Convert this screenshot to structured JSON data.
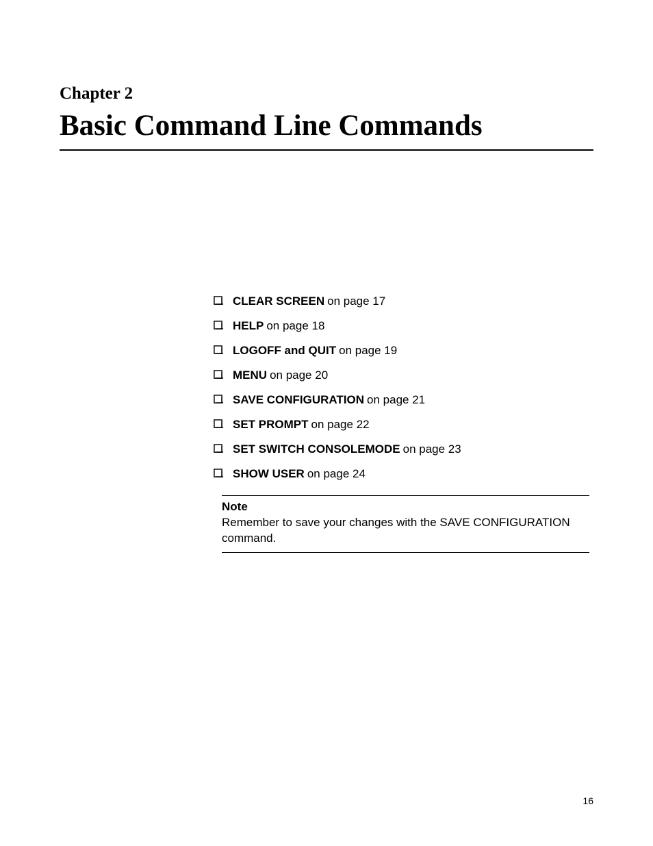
{
  "chapter": {
    "label": "Chapter 2",
    "title": "Basic Command Line Commands"
  },
  "commands": [
    {
      "name": "CLEAR SCREEN",
      "page": "on page 17"
    },
    {
      "name": "HELP",
      "page": "on page 18"
    },
    {
      "name": "LOGOFF and QUIT",
      "page": "on page 19"
    },
    {
      "name": "MENU",
      "page": "on page 20"
    },
    {
      "name": "SAVE CONFIGURATION",
      "page": "on page 21"
    },
    {
      "name": "SET PROMPT",
      "page": "on page 22"
    },
    {
      "name": "SET SWITCH CONSOLEMODE",
      "page": "on page 23"
    },
    {
      "name": "SHOW USER",
      "page": "on page 24"
    }
  ],
  "note": {
    "heading": "Note",
    "body": "Remember to save your changes with the SAVE CONFIGURATION command."
  },
  "footer": {
    "page_number": "16"
  }
}
